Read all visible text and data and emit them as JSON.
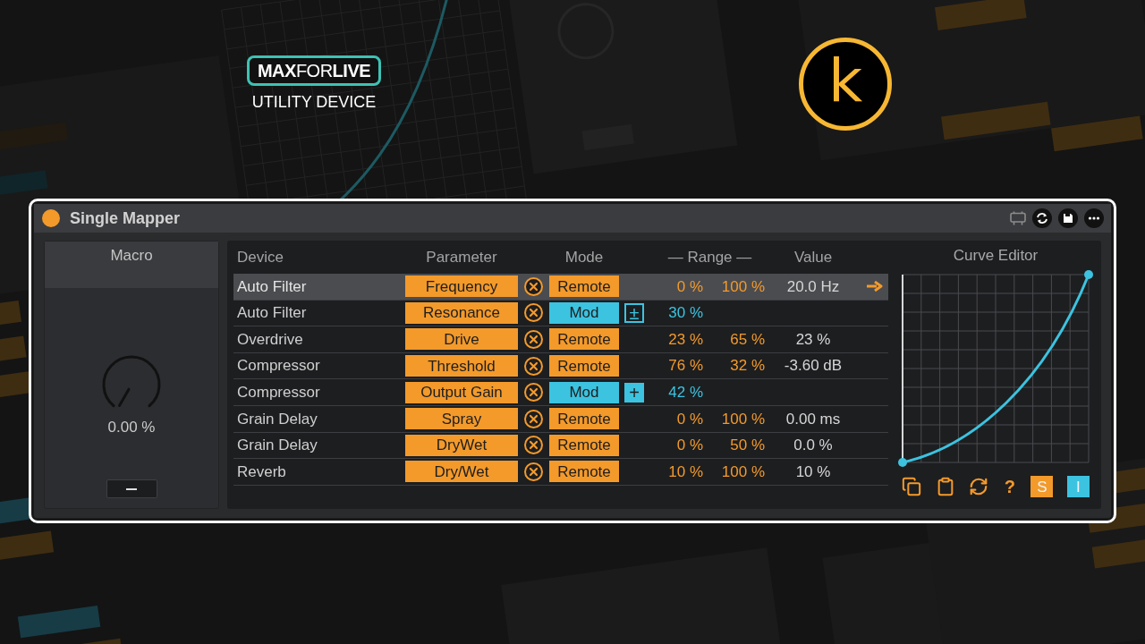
{
  "logo": {
    "badge": "**MAX**FOR**LIVE**",
    "caption": "UTILITY DEVICE"
  },
  "brand_mark": {
    "letter": "k"
  },
  "device": {
    "title": "Single Mapper",
    "on": true,
    "macro": {
      "title": "Macro",
      "knob": {
        "reading": "0.00 %"
      }
    },
    "table": {
      "columns": [
        "Device",
        "Parameter",
        "Mode",
        "— Range —",
        "Value"
      ],
      "rows": [
        {
          "device": "Auto Filter",
          "parameter": "Frequency",
          "mode": {
            "label": "Remote",
            "kind": "remote"
          },
          "min": "0 %",
          "max": "100 %",
          "value": "20.0 Hz",
          "selected": true
        },
        {
          "device": "Auto Filter",
          "parameter": "Resonance",
          "mode": {
            "label": "Mod",
            "kind": "mod"
          },
          "modifier": {
            "symbol": "±",
            "on": false
          },
          "amount": "30 %",
          "selected": false
        },
        {
          "device": "Overdrive",
          "parameter": "Drive",
          "mode": {
            "label": "Remote",
            "kind": "remote"
          },
          "min": "23 %",
          "max": "65 %",
          "value": "23 %",
          "selected": false
        },
        {
          "device": "Compressor",
          "parameter": "Threshold",
          "mode": {
            "label": "Remote",
            "kind": "remote"
          },
          "min": "76 %",
          "max": "32 %",
          "value": "-3.60 dB",
          "selected": false
        },
        {
          "device": "Compressor",
          "parameter": "Output Gain",
          "mode": {
            "label": "Mod",
            "kind": "mod"
          },
          "modifier": {
            "symbol": "+",
            "on": true
          },
          "amount": "42 %",
          "selected": false
        },
        {
          "device": "Grain Delay",
          "parameter": "Spray",
          "mode": {
            "label": "Remote",
            "kind": "remote"
          },
          "min": "0 %",
          "max": "100 %",
          "value": "0.00 ms",
          "selected": false
        },
        {
          "device": "Grain Delay",
          "parameter": "DryWet",
          "mode": {
            "label": "Remote",
            "kind": "remote"
          },
          "min": "0 %",
          "max": "50 %",
          "value": "0.0 %",
          "selected": false
        },
        {
          "device": "Reverb",
          "parameter": "Dry/Wet",
          "mode": {
            "label": "Remote",
            "kind": "remote"
          },
          "min": "10 %",
          "max": "100 %",
          "value": "10 %",
          "selected": false
        }
      ]
    },
    "curve_editor": {
      "title": "Curve Editor",
      "help": "?",
      "toggles": [
        {
          "label": "S",
          "on": true,
          "color": "#f39a2b"
        },
        {
          "label": "I",
          "on": true,
          "color": "#3cc3e0"
        }
      ]
    }
  }
}
